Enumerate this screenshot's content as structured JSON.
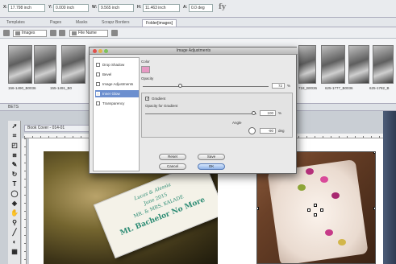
{
  "measurements": {
    "x_label": "X:",
    "x_value": "17.798 inch",
    "y_label": "Y:",
    "y_value": "0.000 inch",
    "w_label": "W:",
    "w_value": "9.565 inch",
    "h_label": "H:",
    "h_value": "11.463 inch",
    "angle_label": "A:",
    "angle_value": "0.0 deg",
    "logo": "fy"
  },
  "tabs": [
    {
      "label": "Templates"
    },
    {
      "label": "Pages"
    },
    {
      "label": "Masks"
    },
    {
      "label": "Scrapz Borders"
    },
    {
      "label": "Folder[images]"
    }
  ],
  "library": {
    "source_select": "Images",
    "sort_select": "File Name"
  },
  "thumbnails": [
    {
      "caption": "156-1490_B0036"
    },
    {
      "caption": "155-1491_B0"
    },
    {
      "caption": "718_B0036"
    },
    {
      "caption": "625-1777_B0036"
    },
    {
      "caption": "625-1782_B"
    }
  ],
  "panel_strip": {
    "label": "BETS"
  },
  "document": {
    "tab_title": "Book Cover - 014-01"
  },
  "sign_card": {
    "line1": "Lucas & Alessia",
    "line2": "June 2015",
    "line3": "MR. & MRS. KALADE",
    "line4": "Mt. Bachelor No More"
  },
  "dialog": {
    "title": "Image Adjustments",
    "list_items": [
      {
        "label": "Drop Shadow"
      },
      {
        "label": "Bevel"
      },
      {
        "label": "Image Adjustments"
      },
      {
        "label": "Inner Glow"
      },
      {
        "label": "Transparency"
      }
    ],
    "color_label": "Color",
    "swatch_color": "#e79ac4",
    "opacity_label": "Opacity",
    "opacity_value": "72",
    "opacity_unit": "%",
    "gradient_checkbox_label": "Gradient",
    "gradient_opacity_label": "Opacity for Gradient",
    "gradient_opacity_value": "100",
    "gradient_opacity_unit": "%",
    "angle_label": "Angle",
    "angle_value": "-90",
    "angle_unit": "deg",
    "reset_label": "Reset",
    "save_label": "Save",
    "cancel_label": "Cancel",
    "ok_label": "OK"
  }
}
